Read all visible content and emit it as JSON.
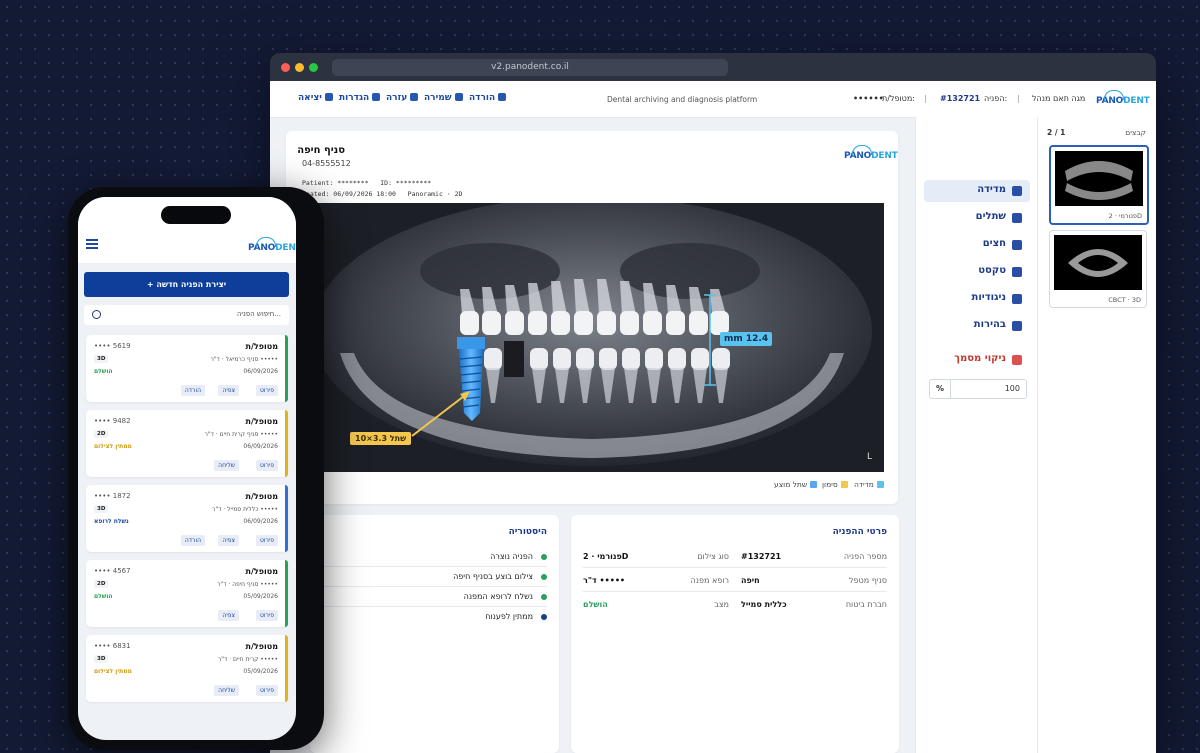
{
  "browser": {
    "url": "v2.panodent.co.il"
  },
  "brand": {
    "name": "PANODENT",
    "pano": "PANO",
    "dent": "DENT",
    "primary": "#1b57b5",
    "accent": "#2aa6dd"
  },
  "nav": {
    "logout": "יציאה",
    "settings": "הגדרות",
    "help": "עזרה",
    "save": "שמירה",
    "download": "הורדה",
    "tagline": "Dental archiving and diagnosis platform",
    "patient_label": "מטופל/ת:",
    "patient_value": "••••••",
    "referral_label": "הפניה:",
    "referral_value": "#132721",
    "user": "מגה תאם מנהל"
  },
  "doc": {
    "branch": "סניף חיפה",
    "phone": "04-8555512",
    "line1": "Patient: ********   ID: *********",
    "line2": "reated: 06/09/2026 18:00   Panoramic · 2D",
    "measure": "mm 12.4",
    "implant": "שתל 3.3×10",
    "side": "L",
    "legend": [
      {
        "label": "מדידה",
        "color": "#5bc2ee"
      },
      {
        "label": "סימון",
        "color": "#f3c64e"
      },
      {
        "label": "שתל מוצע",
        "color": "#5aa7ee"
      }
    ]
  },
  "tools": {
    "items": [
      "מדידה",
      "שתלים",
      "חצים",
      "טקסט",
      "ניגודיות",
      "בהירות"
    ],
    "clear": "ניקוי מסמך",
    "zoom_unit": "%",
    "zoom_value": "100"
  },
  "files": {
    "title": "קבצים",
    "count": "2 / 1",
    "items": [
      {
        "caption": "פנורמי · 2D"
      },
      {
        "caption": "CBCT · 3D"
      }
    ]
  },
  "history": {
    "title": "היסטוריה",
    "items": [
      {
        "text": "הפניה נוצרה",
        "color": "#2aa05a"
      },
      {
        "text": "צילום בוצע בסניף חיפה",
        "color": "#2aa05a"
      },
      {
        "text": "נשלח לרופא המפנה",
        "color": "#2aa05a"
      },
      {
        "text": "ממתין לפענוח",
        "color": "#1c3f8c"
      }
    ]
  },
  "details": {
    "title": "פרטי ההפניה",
    "rows": [
      {
        "l1": "מספר הפניה",
        "v1": "#132721",
        "l2": "סוג צילום",
        "v2": "פנורמי · 2D"
      },
      {
        "l1": "סניף מטפל",
        "v1": "חיפה",
        "l2": "רופא מפנה",
        "v2": "ד\"ר •••••"
      },
      {
        "l1": "חברת ביטוח",
        "v1": "כללית סמייל",
        "l2": "מצב",
        "v2": "הושלם"
      }
    ],
    "status_color": "#2aa05a"
  },
  "mobile": {
    "new_button": "+ יצירת הפניה חדשה",
    "search_placeholder": "חיפוש הפניה...",
    "cards": [
      {
        "title": "מטופל/ת",
        "id": "•••• 5619",
        "tag": "3D",
        "sub": "סניף כרמיאל · ד\"ר •••••",
        "status": "הושלם",
        "status_color": "#2aa05a",
        "date": "06/09/2026",
        "bar": "#2aa05a",
        "buttons": [
          "פירוט",
          "צפיה",
          "הורדה"
        ]
      },
      {
        "title": "מטופל/ת",
        "id": "•••• 9482",
        "tag": "2D",
        "sub": "סניף קרית חיים · ד\"ר •••••",
        "status": "ממתין לצילום",
        "status_color": "#d19b12",
        "date": "06/09/2026",
        "bar": "#e0b21c",
        "buttons": [
          "פירוט",
          "שליחה"
        ]
      },
      {
        "title": "מטופל/ת",
        "id": "•••• 1872",
        "tag": "3D",
        "sub": "כללית סמייל · ד\"ר •••••",
        "status": "נשלח לרופא",
        "status_color": "#1d4aa0",
        "date": "06/09/2026",
        "bar": "#2f6fd6",
        "buttons": [
          "פירוט",
          "צפיה",
          "הורדה"
        ]
      },
      {
        "title": "מטופל/ת",
        "id": "•••• 4567",
        "tag": "2D",
        "sub": "סניף חיפה · ד\"ר •••••",
        "status": "הושלם",
        "status_color": "#2aa05a",
        "date": "05/09/2026",
        "bar": "#2aa05a",
        "buttons": [
          "פירוט",
          "צפיה"
        ]
      },
      {
        "title": "מטופל/ת",
        "id": "•••• 6831",
        "tag": "3D",
        "sub": "קרית חיים · ד\"ר •••••",
        "status": "ממתין לצילום",
        "status_color": "#d19b12",
        "date": "05/09/2026",
        "bar": "#e0b21c",
        "buttons": [
          "פירוט",
          "שליחה"
        ]
      }
    ]
  }
}
